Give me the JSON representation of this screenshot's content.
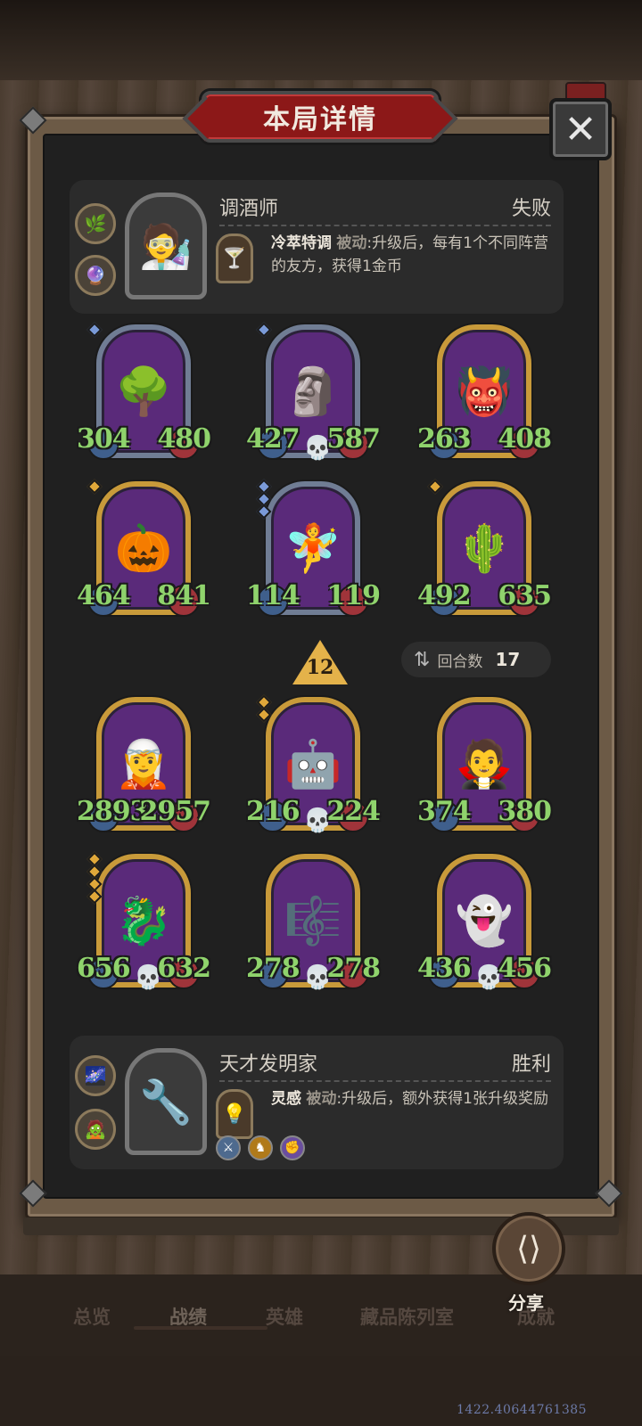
{
  "dialog": {
    "title": "本局详情",
    "close_icon": "✕"
  },
  "opponent": {
    "name": "调酒师",
    "result": "失败",
    "skill_name": "冷萃特调",
    "skill_type": "被动",
    "skill_desc": ":升级后，每有1个不同阵营的友方，获得1金币"
  },
  "board_top": [
    {
      "atk": "304",
      "hp": "480",
      "frame": "blue",
      "stars": 1,
      "star_color": "blue",
      "dead": false,
      "art": "🌳"
    },
    {
      "atk": "427",
      "hp": "587",
      "frame": "blue",
      "stars": 1,
      "star_color": "blue",
      "dead": true,
      "art": "🗿"
    },
    {
      "atk": "263",
      "hp": "408",
      "frame": "gold",
      "stars": 0,
      "star_color": "blue",
      "dead": false,
      "art": "👹"
    },
    {
      "atk": "464",
      "hp": "841",
      "frame": "gold",
      "stars": 1,
      "star_color": "gold",
      "dead": false,
      "art": "🎃"
    },
    {
      "atk": "114",
      "hp": "119",
      "frame": "blue",
      "stars": 3,
      "star_color": "blue",
      "dead": false,
      "art": "🧚"
    },
    {
      "atk": "492",
      "hp": "635",
      "frame": "gold",
      "stars": 1,
      "star_color": "gold",
      "dead": false,
      "art": "🌵"
    }
  ],
  "round": {
    "tier": "12",
    "label": "回合数",
    "value": "17"
  },
  "board_bottom": [
    {
      "atk": "2893",
      "hp": "2957",
      "frame": "gold",
      "stars": 0,
      "star_color": "gold",
      "dead": false,
      "art": "🧝"
    },
    {
      "atk": "216",
      "hp": "224",
      "frame": "gold",
      "stars": 2,
      "star_color": "gold",
      "dead": true,
      "art": "🤖"
    },
    {
      "atk": "374",
      "hp": "380",
      "frame": "gold",
      "stars": 0,
      "star_color": "gold",
      "dead": false,
      "art": "🧛"
    },
    {
      "atk": "656",
      "hp": "632",
      "frame": "gold",
      "stars": 4,
      "star_color": "gold",
      "dead": true,
      "art": "🐉"
    },
    {
      "atk": "278",
      "hp": "278",
      "frame": "gold",
      "stars": 0,
      "star_color": "gold",
      "dead": true,
      "art": "🎼"
    },
    {
      "atk": "436",
      "hp": "456",
      "frame": "gold",
      "stars": 0,
      "star_color": "gold",
      "dead": true,
      "art": "👻"
    }
  ],
  "player": {
    "name": "天才发明家",
    "result": "胜利",
    "skill_name": "灵感",
    "skill_type": "被动",
    "skill_desc": ":升级后，额外获得1张升级奖励"
  },
  "nav": {
    "items": [
      "总览",
      "战绩",
      "英雄",
      "藏品陈列室",
      "成就"
    ]
  },
  "share": {
    "label": "分享"
  },
  "build_id": "1422.40644761385",
  "colors": {
    "panel": "#202020",
    "stat_green": "#8fd36c",
    "title_red": "#8c1818",
    "gold_frame": "#c89a3a",
    "blue_frame": "#707d94"
  }
}
